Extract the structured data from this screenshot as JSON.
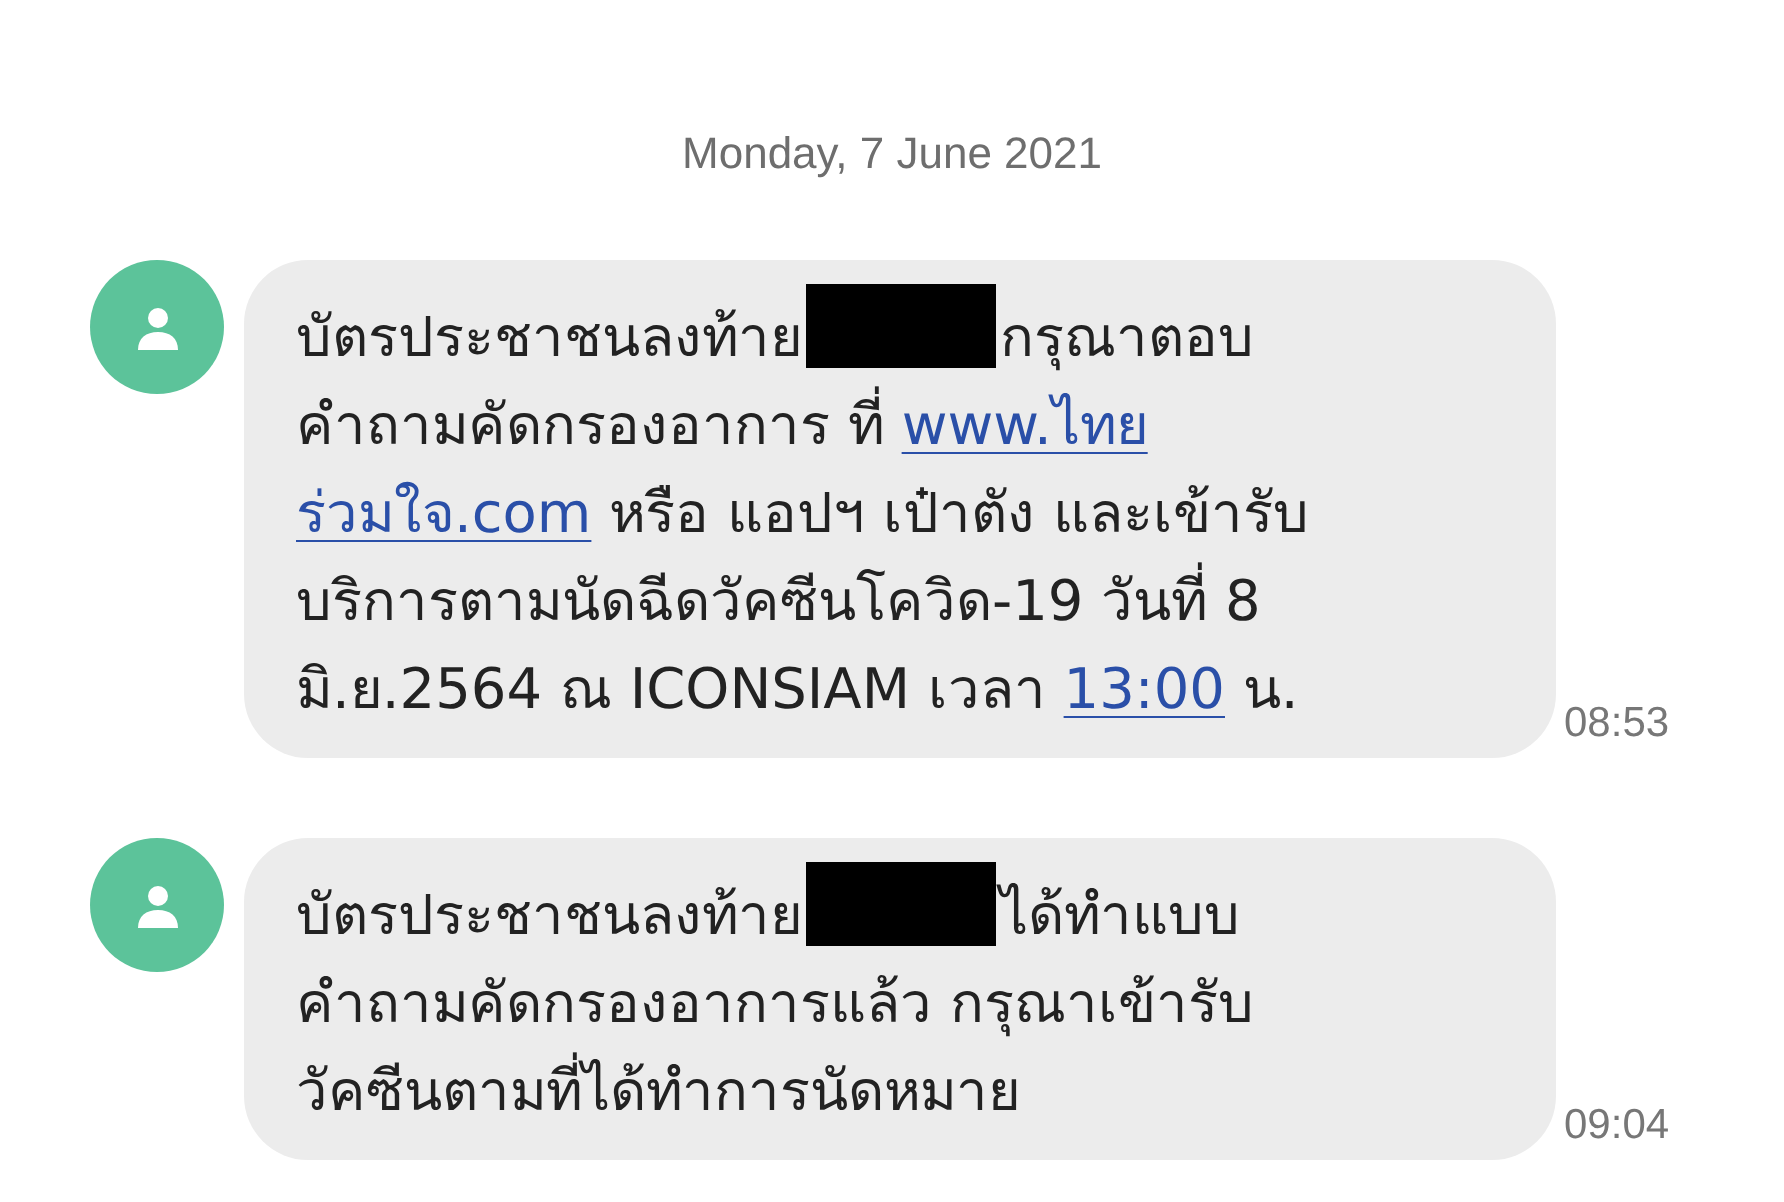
{
  "date_header": "Monday, 7 June 2021",
  "messages": [
    {
      "time": "08:53",
      "lines": [
        [
          {
            "kind": "text",
            "text": "บัตรประชาชนลงท้าย"
          },
          {
            "kind": "redacted"
          },
          {
            "kind": "text",
            "text": "กรุณาตอบ"
          }
        ],
        [
          {
            "kind": "text",
            "text": "คำถามคัดกรองอาการ ที่ "
          },
          {
            "kind": "link",
            "text": "www.ไทย"
          }
        ],
        [
          {
            "kind": "link",
            "text": "ร่วมใจ.com"
          },
          {
            "kind": "text",
            "text": " หรือ แอปฯ เป๋าตัง และเข้ารับ"
          }
        ],
        [
          {
            "kind": "text",
            "text": "บริการตามนัดฉีดวัคซีนโควิด-19 วันที่ 8"
          }
        ],
        [
          {
            "kind": "text",
            "text": "มิ.ย.2564 ณ ICONSIAM เวลา "
          },
          {
            "kind": "link",
            "text": "13:00"
          },
          {
            "kind": "text",
            "text": " น."
          }
        ]
      ]
    },
    {
      "time": "09:04",
      "lines": [
        [
          {
            "kind": "text",
            "text": "บัตรประชาชนลงท้าย"
          },
          {
            "kind": "redacted"
          },
          {
            "kind": "text",
            "text": "ได้ทำแบบ"
          }
        ],
        [
          {
            "kind": "text",
            "text": "คำถามคัดกรองอาการแล้ว กรุณาเข้ารับ"
          }
        ],
        [
          {
            "kind": "text",
            "text": "วัคซีนตามที่ได้ทำการนัดหมาย"
          }
        ]
      ]
    }
  ]
}
